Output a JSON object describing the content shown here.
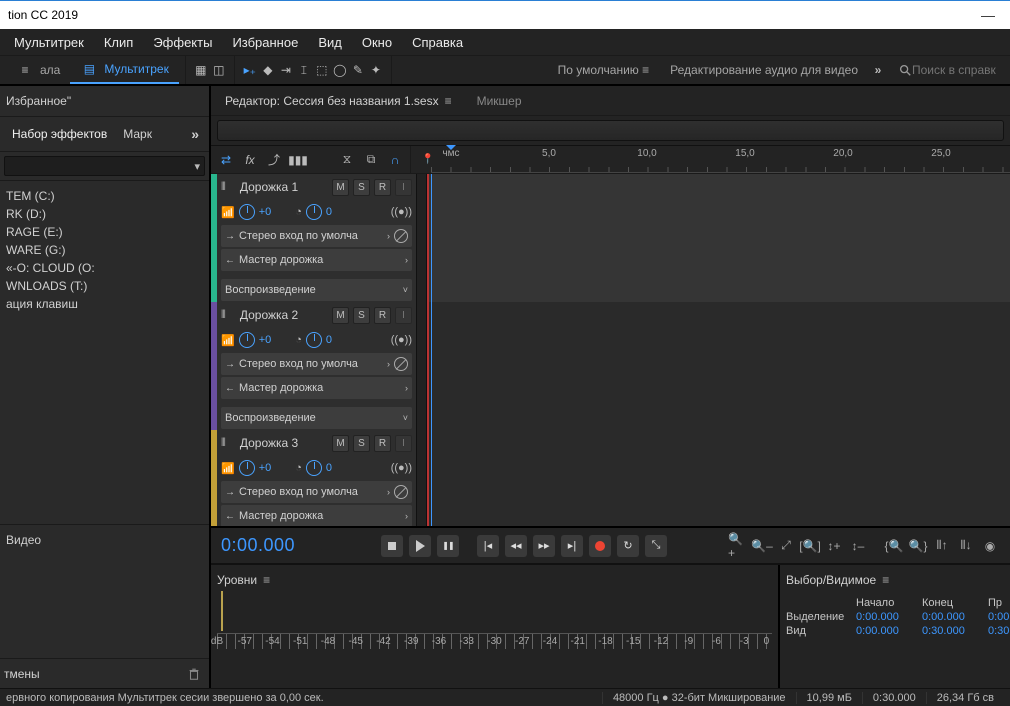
{
  "app": {
    "title": "tion CC 2019"
  },
  "menu": {
    "items": [
      "Мультитрек",
      "Клип",
      "Эффекты",
      "Избранное",
      "Вид",
      "Окно",
      "Справка"
    ]
  },
  "toolbar": {
    "view_tabs": {
      "waveform": "ала",
      "multitrack": "Мультитрек"
    },
    "workspace_default": "По умолчанию",
    "workspace_audiovideo": "Редактирование аудио для видео",
    "search_placeholder": "Поиск в справк"
  },
  "left": {
    "favorites": "Избранное\"",
    "effects_tab": "Набор эффектов",
    "markers_tab": "Марк",
    "drives": [
      "TEM (C:)",
      "RK (D:)",
      "RAGE (E:)",
      "WARE (G:)",
      "«-O: CLOUD (O:",
      "WNLOADS (T:)",
      "ация клавиш"
    ],
    "video": "Видео",
    "undo": "тмены"
  },
  "editor": {
    "tab_label": "Редактор: Сессия без названия 1.sesx",
    "mixer": "Микшер"
  },
  "ruler": {
    "unit": "чмс",
    "marks": [
      "5,0",
      "10,0",
      "15,0",
      "20,0",
      "25,0"
    ]
  },
  "tracks": [
    {
      "name": "Дорожка 1",
      "color": "#29b68e",
      "vol": "+0",
      "pan": "0",
      "input": "Стерео вход по умолча",
      "output": "Мастер дорожка",
      "mode": "Воспроизведение"
    },
    {
      "name": "Дорожка 2",
      "color": "#6a4fa0",
      "vol": "+0",
      "pan": "0",
      "input": "Стерео вход по умолча",
      "output": "Мастер дорожка",
      "mode": "Воспроизведение"
    },
    {
      "name": "Дорожка 3",
      "color": "#c3a038",
      "vol": "+0",
      "pan": "0",
      "input": "Стерео вход по умолча",
      "output": "Мастер дорожка",
      "mode": ""
    }
  ],
  "transport": {
    "timecode": "0:00.000"
  },
  "levels": {
    "title": "Уровни",
    "scale": [
      "dB",
      "-57",
      "-54",
      "-51",
      "-48",
      "-45",
      "-42",
      "-39",
      "-36",
      "-33",
      "-30",
      "-27",
      "-24",
      "-21",
      "-18",
      "-15",
      "-12",
      "-9",
      "-6",
      "-3",
      "0"
    ]
  },
  "selection": {
    "title": "Выбор/Видимое",
    "headers": {
      "start": "Начало",
      "end": "Конец",
      "dur": "Пр"
    },
    "rows": {
      "sel": {
        "label": "Выделение",
        "start": "0:00.000",
        "end": "0:00.000",
        "dur": "0:00"
      },
      "view": {
        "label": "Вид",
        "start": "0:00.000",
        "end": "0:30.000",
        "dur": "0:30"
      }
    }
  },
  "status": {
    "msg": "ервного копирования Мультитрек сесии звершено за 0,00 сек.",
    "sample": "48000 Гц ● 32-бит Микширование",
    "mem": "10,99 мБ",
    "dur": "0:30.000",
    "disk": "26,34 Гб св"
  }
}
